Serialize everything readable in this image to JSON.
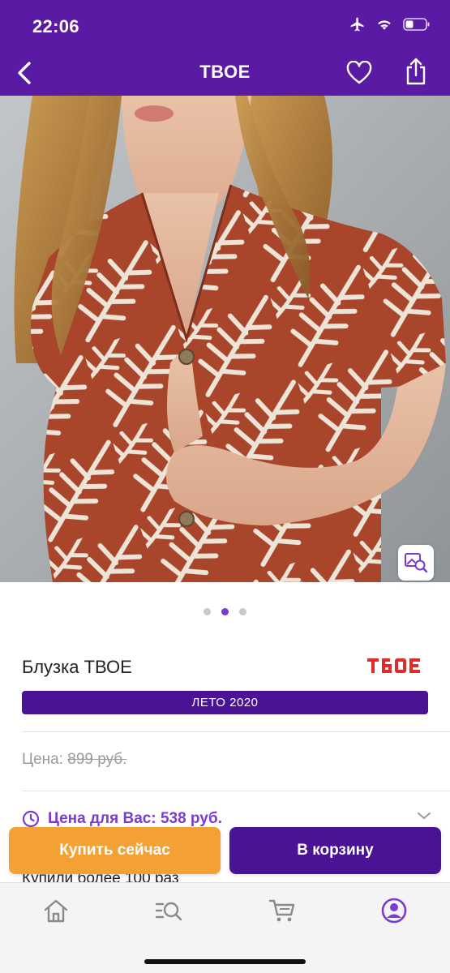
{
  "status_bar": {
    "time": "22:06"
  },
  "header": {
    "title": "ТВОЕ"
  },
  "product": {
    "name": "Блузка ТВОЕ",
    "brand_logo": "TBOE",
    "season_label": "ЛЕТО 2020",
    "price_label": "Цена:",
    "price_old": "899 руб.",
    "offer_label": "Цена для Вас: 538 руб.",
    "bought_text": "Купили более 100 раз"
  },
  "carousel": {
    "total": 3,
    "active_index": 1
  },
  "actions": {
    "buy_now": "Купить сейчас",
    "add_to_cart": "В корзину"
  },
  "tabbar": {
    "tabs": [
      "home-icon",
      "search-list-icon",
      "cart-icon",
      "profile-icon"
    ],
    "active_index": 3
  },
  "colors": {
    "primary": "#5b1aa3",
    "button_purple": "#4a1396",
    "accent_purple": "#7b3bd0",
    "orange": "#f3a133",
    "brand_red": "#e02b2b",
    "print_rust": "#a8452a"
  }
}
